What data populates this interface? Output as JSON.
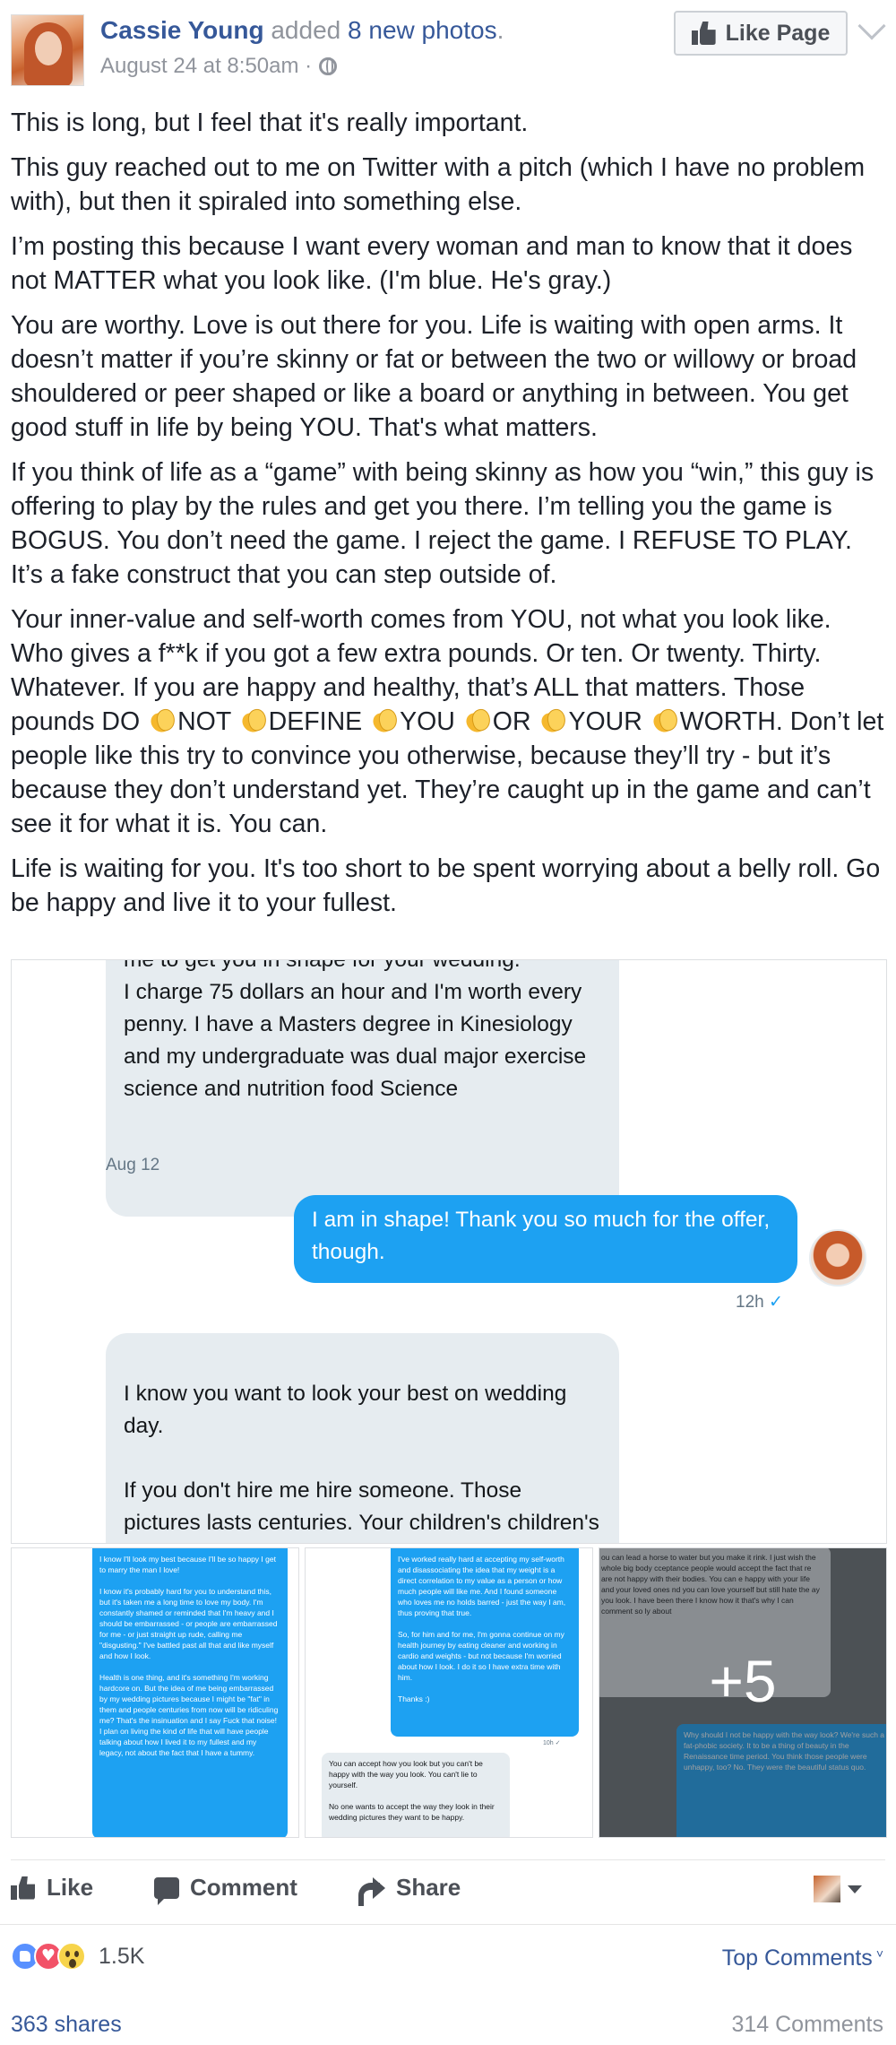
{
  "post": {
    "author": "Cassie Young",
    "action_prefix": "added",
    "action_count": "8 new photos",
    "action_suffix": ".",
    "timestamp": "August 24 at 8:50am ·",
    "like_page_label": "Like Page",
    "paragraphs": [
      "This is long, but I feel that it's really important.",
      "This guy reached out to me on Twitter with a pitch (which I have no problem with), but then it spiraled into something else.",
      "I’m posting this because I want every woman and man to know that it does not MATTER what you look like. (I'm blue. He's gray.)",
      "You are worthy. Love is out there for you. Life is waiting with open arms. It doesn’t matter if you’re skinny or fat or between the two or willowy or broad shouldered or peer shaped or like a board or anything in between. You get good stuff in life by being YOU. That's what matters.",
      "If you think of life as a “game” with being skinny as how you “win,” this guy is offering to play by the rules and get you there. I’m telling you the game is BOGUS. You don’t need the game. I reject the game. I REFUSE TO PLAY. It’s a fake construct that you can step outside of."
    ],
    "para6_start": "Your inner-value and self-worth comes from YOU, not what you look like. Who gives a f**k if you got a few extra pounds. Or ten. Or twenty. Thirty. Whatever. If you are happy and healthy, that’s ALL that matters. Those pounds DO",
    "para6_words": [
      "NOT",
      "DEFINE",
      "YOU",
      "OR",
      "YOUR",
      "WORTH."
    ],
    "para6_end": "Don’t let people like this try to convince you otherwise, because they’ll try - but it’s because they don’t understand yet. They’re caught up in the game and can’t see it for what it is. You can.",
    "para7": "Life is waiting for you. It's too short to be spent worrying about a belly roll. Go be happy and live it to your fullest."
  },
  "chat": {
    "msg1_partial": "me to get you in shape for your wedding.",
    "msg1": "I charge 75 dollars an hour and I'm worth every penny. I have a Masters degree in Kinesiology and my undergraduate was dual major exercise science and nutrition food Science",
    "msg1_date": "Aug 12",
    "reply": "I am in shape! Thank you so much for the offer, though.",
    "reply_time": "12h",
    "reply_check": "✓",
    "msg2": "I know you want to look your best on wedding day.\n\nIf you don't hire me hire someone. Those pictures lasts centuries. Your children's children's children will still have those"
  },
  "thumbnails": {
    "t1_text": "I know I'll look my best because I'll be so happy I get to marry the man I love!\n\nI know it's probably hard for you to understand this, but it's taken me a long time to love my body. I'm constantly shamed or reminded that I'm heavy and I should be embarrassed - or people are embarrassed for me - or just straight up rude, calling me \"disgusting.\" I've battled past all that and like myself and how I look.\n\nHealth is one thing, and it's something I'm working hardcore on. But the idea of me being embarrassed by my wedding pictures because I might be \"fat\" in them and people centuries from now will be ridiculing me? That's the insinuation and I say Fuck that noise! I plan on living the kind of life that will have people talking about how I lived it to my fullest and my legacy, not about the fact that I have a tummy.",
    "t2_text_blue": "I've worked really hard at accepting my self-worth and disassociating the idea that my weight is a direct correlation to my value as a person or how much people will like me. And I found someone who loves me no holds barred - just the way I am, thus proving that true.\n\nSo, for him and for me, I'm gonna continue on my health journey by eating cleaner and working in cardio and weights - but not because I'm worried about how I look. I do it so I have extra time with him.\n\nThanks :)",
    "t2_time": "10h ✓",
    "t2_text_gray": "You can accept how you look but you can't be happy with the way you look. You can't lie to yourself.\n\nNo one wants to accept the way they look in their wedding pictures they want to be happy.",
    "t3_text_gray": "ou can lead a horse to water but you make it rink. I just wish the whole big body cceptance people would accept the fact that re are not happy with their bodies. You can e happy with your life and your loved ones nd you can love yourself but still hate the ay you look. I have been there I know how it that's why I can comment so     ly about",
    "t3_text_blue": "Why should I not be happy with the way look? We're such a fat-phobic society. It to be a thing of beauty in the Renaissance time period. You think those people were unhappy, too? No. They were the beautiful status quo.",
    "more_count": "+5"
  },
  "actions": {
    "like": "Like",
    "comment": "Comment",
    "share": "Share"
  },
  "summary": {
    "reaction_count": "1.5K",
    "top_comments": "Top Comments",
    "top_comments_caret": "˅",
    "shares": "363 shares",
    "comments": "314 Comments"
  },
  "colors": {
    "facebook_blue": "#365899",
    "twitter_blue": "#1da1f2",
    "bubble_gray": "#e6ecf0"
  },
  "icons": [
    "globe-icon",
    "like-icon",
    "chevron-down-icon",
    "clap-icon",
    "checkmark-icon",
    "comment-icon",
    "share-icon",
    "caret-down-icon",
    "like-reaction-icon",
    "love-reaction-icon",
    "wow-reaction-icon"
  ]
}
